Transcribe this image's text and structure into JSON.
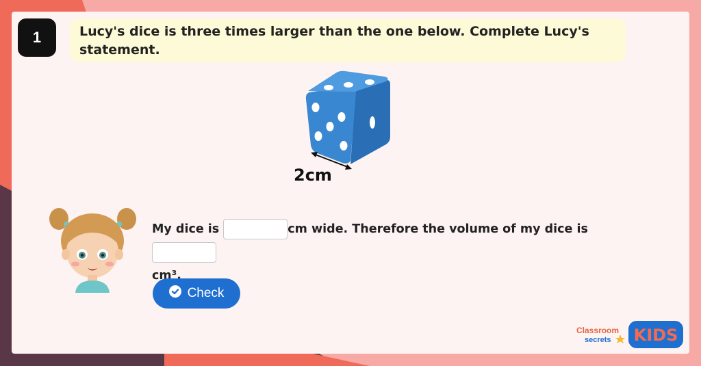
{
  "question": {
    "number": "1",
    "text": "Lucy's dice is three times larger than the one below. Complete Lucy's statement."
  },
  "dice": {
    "size_label": "2cm",
    "color": "#3a87d1"
  },
  "statement": {
    "part1": "My dice is",
    "part2": "cm wide. Therefore the volume of my dice is",
    "part3": "cm³.",
    "width_answer_value": "",
    "volume_answer_value": ""
  },
  "check_button": {
    "label": "Check",
    "color": "#1f6fd1"
  },
  "branding": {
    "classroom_word": "Classroom",
    "secrets_word": "secrets",
    "kids_word": "KIDS"
  },
  "icons": {
    "check": "check-circle-icon",
    "character": "girl-avatar",
    "dice": "dice-illustration"
  }
}
